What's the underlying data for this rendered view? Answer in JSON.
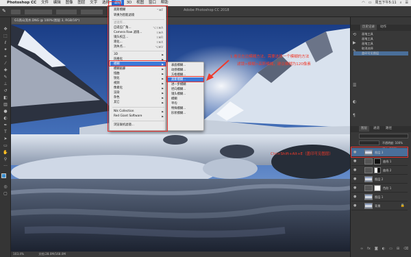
{
  "menubar": {
    "app_name": "Photoshop CC",
    "items": [
      "文件",
      "编辑",
      "图像",
      "图层",
      "文字",
      "选择",
      "滤镜",
      "3D",
      "视图",
      "窗口",
      "帮助"
    ],
    "active_item": "滤镜",
    "clock": "周五下午5:11"
  },
  "window_title": "Adobe Photoshop CC 2018",
  "document_tab": "G1高山流水.DNG @ 100%(图层 3, RGB/16*)",
  "status": {
    "zoom": "103.4%",
    "doc_size": "文档:28.0M/168.0M"
  },
  "filter_menu": {
    "items": [
      {
        "label": "高斯模糊",
        "shortcut": "⌃⌘F",
        "disabled": false
      },
      {
        "label": "转换为智能滤镜",
        "shortcut": "",
        "disabled": false
      },
      {
        "label": "滤镜库...",
        "shortcut": "",
        "disabled": true
      },
      {
        "label": "自适应广角...",
        "shortcut": "⌥⇧⌘A",
        "disabled": false
      },
      {
        "label": "Camera Raw 滤镜...",
        "shortcut": "⇧⌘A",
        "disabled": false
      },
      {
        "label": "镜头校正...",
        "shortcut": "⇧⌘R",
        "disabled": false
      },
      {
        "label": "液化...",
        "shortcut": "⇧⌘X",
        "disabled": false
      },
      {
        "label": "消失点...",
        "shortcut": "⌥⌘V",
        "disabled": false
      },
      {
        "label": "3D",
        "shortcut": "",
        "disabled": false
      },
      {
        "label": "风格化",
        "shortcut": "",
        "disabled": false
      },
      {
        "label": "模糊",
        "shortcut": "",
        "disabled": false
      },
      {
        "label": "模糊画廊",
        "shortcut": "",
        "disabled": false
      },
      {
        "label": "扭曲",
        "shortcut": "",
        "disabled": false
      },
      {
        "label": "锐化",
        "shortcut": "",
        "disabled": false
      },
      {
        "label": "视频",
        "shortcut": "",
        "disabled": false
      },
      {
        "label": "像素化",
        "shortcut": "",
        "disabled": false
      },
      {
        "label": "渲染",
        "shortcut": "",
        "disabled": false
      },
      {
        "label": "杂色",
        "shortcut": "",
        "disabled": false
      },
      {
        "label": "其它",
        "shortcut": "",
        "disabled": false
      },
      {
        "label": "Nik Collection",
        "shortcut": "",
        "disabled": false
      },
      {
        "label": "Red Giant Software",
        "shortcut": "",
        "disabled": false
      },
      {
        "label": "浏览联机滤镜...",
        "shortcut": "",
        "disabled": false
      }
    ]
  },
  "blur_submenu": {
    "items": [
      "表面模糊...",
      "动感模糊...",
      "方框模糊...",
      "高斯模糊...",
      "进一步模糊",
      "径向模糊...",
      "镜头模糊...",
      "模糊",
      "平均",
      "特殊模糊...",
      "形状模糊..."
    ],
    "highlighted": "高斯模糊..."
  },
  "annotations": {
    "top": "1.看见左边模糊方法，需要选择一个模糊的方法",
    "top2": "滤镜>模糊>高斯模糊，建议模糊为120像素",
    "bottom": "Ctrl+Shift+Alt+E（盖印可见图层）"
  },
  "history_panel": {
    "tabs": [
      "历史记录",
      "动作"
    ],
    "items": [
      "画笔工具",
      "画笔工具",
      "画笔工具",
      "取消选择",
      "盖印可见图层"
    ]
  },
  "layers_panel": {
    "tabs": [
      "图层",
      "通道",
      "路径"
    ],
    "opacity_label": "不透明度: 100%",
    "fill_label": "填充: 100%",
    "layers": [
      {
        "name": "图层 3",
        "selected": true
      },
      {
        "name": "曲线 1",
        "selected": false
      },
      {
        "name": "曲线 2",
        "selected": false
      },
      {
        "name": "图层 2",
        "selected": false
      },
      {
        "name": "色阶 1",
        "selected": false
      },
      {
        "name": "图层 1",
        "selected": false
      },
      {
        "name": "背景",
        "selected": false
      }
    ]
  },
  "colors": {
    "accent": "#2a6bd1",
    "annotation": "#f03a2a"
  }
}
